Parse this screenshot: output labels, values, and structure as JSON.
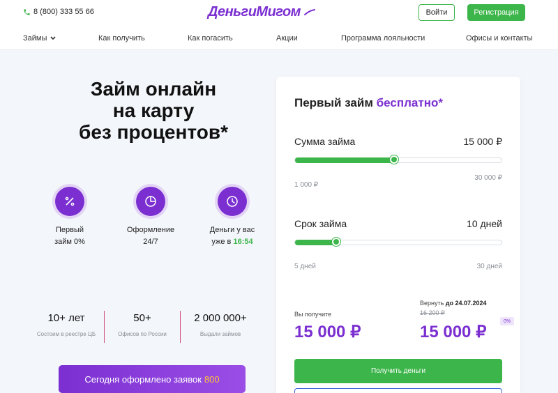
{
  "header": {
    "phone": "8 (800) 333 55 66",
    "logo": "ДеньгиМигом",
    "login_label": "Войти",
    "register_label": "Регистрация",
    "accent_color": "#7b2fd1",
    "green_color": "#3cb54a"
  },
  "nav": {
    "items": [
      {
        "label": "Займы",
        "icon": "chevron-down-icon"
      },
      {
        "label": "Как получить"
      },
      {
        "label": "Как погасить"
      },
      {
        "label": "Акции"
      },
      {
        "label": "Программа лояльности"
      },
      {
        "label": "Офисы и контакты"
      }
    ]
  },
  "hero": {
    "title_line1": "Займ онлайн",
    "title_line2": "на карту",
    "title_line3": "без процентов*"
  },
  "features": [
    {
      "icon": "percent-icon",
      "line1": "Первый",
      "line2": "займ 0%"
    },
    {
      "icon": "pie-chart-icon",
      "line1": "Оформление",
      "line2": "24/7"
    },
    {
      "icon": "clock-icon",
      "line1": "Деньги у вас",
      "line2_prefix": "уже в ",
      "time": "16:54"
    }
  ],
  "stats": [
    {
      "value": "10+ лет",
      "caption": "Состоим в реестре ЦБ"
    },
    {
      "value": "50+",
      "caption": "Офисов по России"
    },
    {
      "value": "2 000 000+",
      "caption": "Выдали займов"
    }
  ],
  "applications_banner": {
    "text": "Сегодня оформлено заявок",
    "count": "800"
  },
  "calculator": {
    "title_prefix": "Первый займ",
    "title_accent": "бесплатно*",
    "amount": {
      "label": "Сумма займа",
      "value": "15 000 ₽",
      "min_label": "1 000 ₽",
      "max_label": "30 000 ₽",
      "fraction": 0.48
    },
    "term": {
      "label": "Срок займа",
      "value": "10 дней",
      "min_label": "5 дней",
      "max_label": "30 дней",
      "fraction": 0.2
    },
    "receive_label": "Вы получите",
    "receive_amount": "15 000 ₽",
    "return_label": "Вернуть",
    "return_date": "до 24.07.2024",
    "return_old": "16 200 ₽",
    "return_amount": "15 000 ₽",
    "percent_badge": "0%",
    "submit_label": "Получить деньги"
  }
}
